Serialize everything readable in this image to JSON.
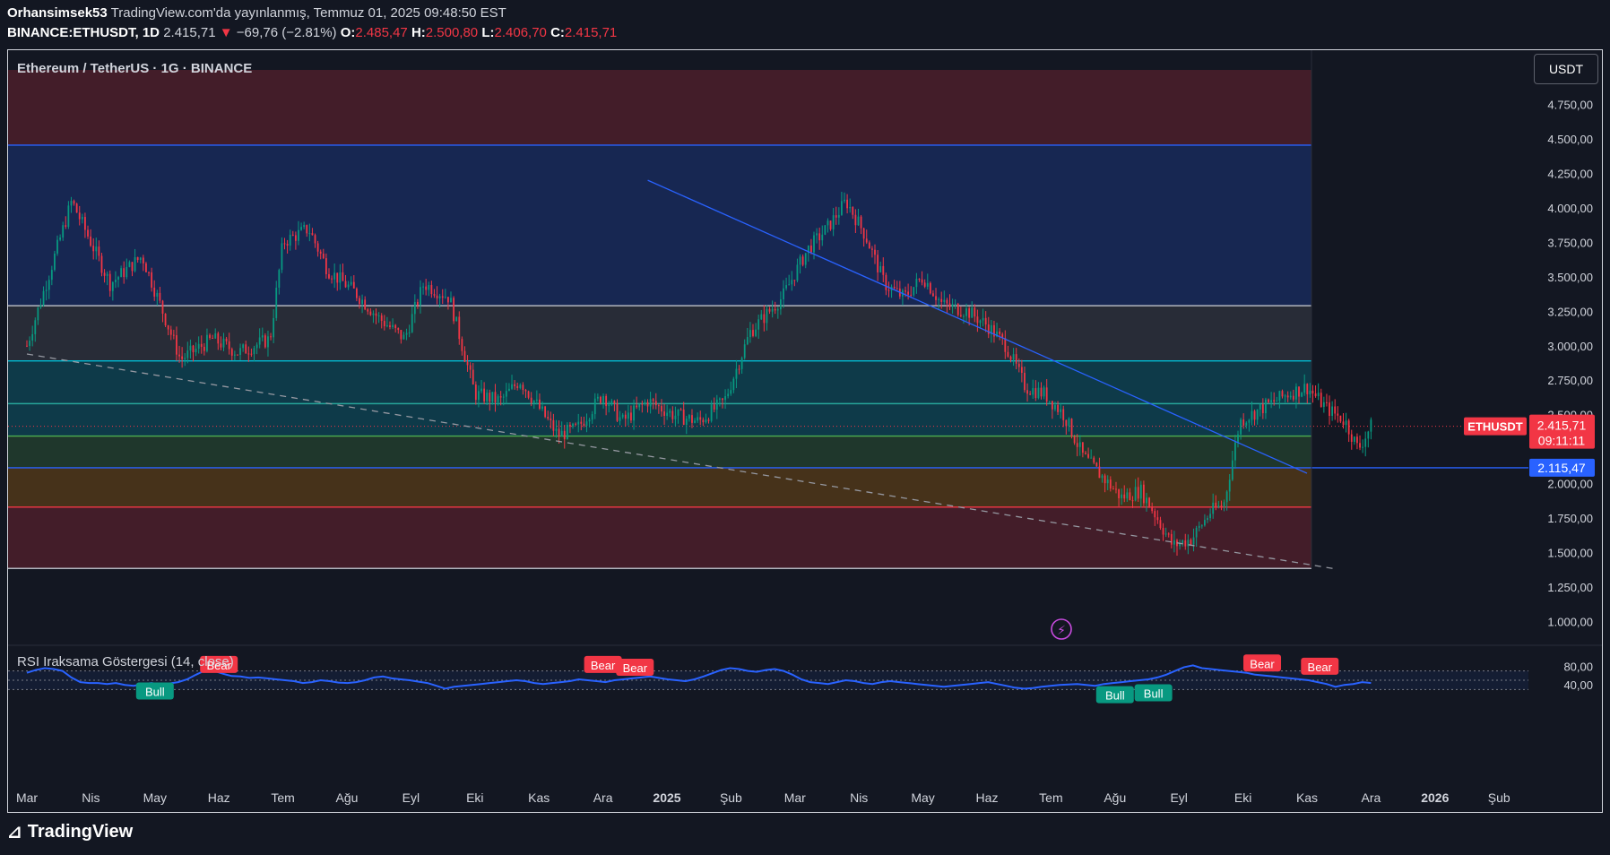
{
  "header": {
    "author": "Orhansimsek53",
    "published": "TradingView.com'da yayınlanmış, Temmuz 01, 2025 09:48:50 EST",
    "symbol_line": "BINANCE:ETHUSDT, 1D",
    "last": "2.415,71",
    "change": "−69,76 (−2.81%)",
    "o_label": "O:",
    "o": "2.485,47",
    "h_label": "H:",
    "h": "2.500,80",
    "l_label": "L:",
    "l": "2.406,70",
    "c_label": "C:",
    "c": "2.415,71"
  },
  "pane": {
    "title": "Ethereum / TetherUS · 1G · BINANCE",
    "currency": "USDT",
    "price_tag_symbol": "ETHUSDT",
    "price_tag_value": "2.415,71",
    "price_tag_timer": "09:11:11",
    "level_tag_value": "2.115,47",
    "rsi_title": "RSI Iraksama Göstergesi (14, close)"
  },
  "brand": {
    "name": "TradingView"
  },
  "colors": {
    "background": "#131722",
    "up": "#089981",
    "down": "#f23645",
    "rsi_line": "#2962ff",
    "trendline": "#2962ff",
    "zone_red": "#f23645",
    "zone_blue": "#2962ff",
    "zone_gray": "#787b86",
    "zone_teal": "#00bcd4",
    "zone_green": "#4caf50",
    "zone_orange": "#ff9800"
  },
  "chart_data": [
    {
      "type": "candlestick",
      "title": "Ethereum / TetherUS · 1G · BINANCE",
      "x_tick_labels": [
        "Mar",
        "Nis",
        "May",
        "Haz",
        "Tem",
        "Ağu",
        "Eyl",
        "Eki",
        "Kas",
        "Ara",
        "2025",
        "Şub",
        "Mar",
        "Nis",
        "May",
        "Haz",
        "Tem",
        "Ağu",
        "Eyl",
        "Eki",
        "Kas",
        "Ara",
        "2026",
        "Şub"
      ],
      "y_tick_labels": [
        "4.750,00",
        "4.500,00",
        "4.250,00",
        "4.000,00",
        "3.750,00",
        "3.500,00",
        "3.250,00",
        "3.000,00",
        "2.750,00",
        "2.500,00",
        "2.000,00",
        "1.750,00",
        "1.500,00",
        "1.250,00",
        "1.000,00"
      ],
      "y_ticks": [
        4750,
        4500,
        4250,
        4000,
        3750,
        3500,
        3250,
        3000,
        2750,
        2500,
        2000,
        1750,
        1500,
        1250,
        1000
      ],
      "ylim": [
        1000,
        4750
      ],
      "price_path": [
        {
          "month": 0.0,
          "price": 3000
        },
        {
          "month": 0.7,
          "price": 4050
        },
        {
          "month": 1.3,
          "price": 3450
        },
        {
          "month": 1.8,
          "price": 3650
        },
        {
          "month": 2.4,
          "price": 2900
        },
        {
          "month": 2.9,
          "price": 3050
        },
        {
          "month": 3.3,
          "price": 2950
        },
        {
          "month": 3.8,
          "price": 3050
        },
        {
          "month": 4.0,
          "price": 3750
        },
        {
          "month": 4.4,
          "price": 3850
        },
        {
          "month": 4.7,
          "price": 3550
        },
        {
          "month": 5.1,
          "price": 3400
        },
        {
          "month": 5.5,
          "price": 3200
        },
        {
          "month": 5.9,
          "price": 3050
        },
        {
          "month": 6.2,
          "price": 3450
        },
        {
          "month": 6.6,
          "price": 3350
        },
        {
          "month": 7.0,
          "price": 2650
        },
        {
          "month": 7.4,
          "price": 2600
        },
        {
          "month": 7.7,
          "price": 2750
        },
        {
          "month": 8.0,
          "price": 2550
        },
        {
          "month": 8.3,
          "price": 2350
        },
        {
          "month": 8.6,
          "price": 2400
        },
        {
          "month": 9.0,
          "price": 2650
        },
        {
          "month": 9.3,
          "price": 2450
        },
        {
          "month": 9.7,
          "price": 2600
        },
        {
          "month": 10.1,
          "price": 2500
        },
        {
          "month": 10.5,
          "price": 2450
        },
        {
          "month": 10.9,
          "price": 2600
        },
        {
          "month": 11.3,
          "price": 3100
        },
        {
          "month": 11.8,
          "price": 3350
        },
        {
          "month": 12.2,
          "price": 3700
        },
        {
          "month": 12.5,
          "price": 3850
        },
        {
          "month": 12.8,
          "price": 4050
        },
        {
          "month": 13.1,
          "price": 3800
        },
        {
          "month": 13.4,
          "price": 3450
        },
        {
          "month": 13.7,
          "price": 3350
        },
        {
          "month": 14.0,
          "price": 3500
        },
        {
          "month": 14.3,
          "price": 3300
        },
        {
          "month": 14.7,
          "price": 3250
        },
        {
          "month": 15.0,
          "price": 3150
        },
        {
          "month": 15.3,
          "price": 3000
        },
        {
          "month": 15.6,
          "price": 2700
        },
        {
          "month": 15.9,
          "price": 2650
        },
        {
          "month": 16.2,
          "price": 2500
        },
        {
          "month": 16.5,
          "price": 2200
        },
        {
          "month": 16.8,
          "price": 2050
        },
        {
          "month": 17.1,
          "price": 1900
        },
        {
          "month": 17.4,
          "price": 1950
        },
        {
          "month": 17.6,
          "price": 1800
        },
        {
          "month": 17.9,
          "price": 1550
        },
        {
          "month": 18.2,
          "price": 1600
        },
        {
          "month": 18.5,
          "price": 1800
        },
        {
          "month": 18.7,
          "price": 1850
        },
        {
          "month": 18.95,
          "price": 2450
        },
        {
          "month": 19.3,
          "price": 2550
        },
        {
          "month": 19.7,
          "price": 2650
        },
        {
          "month": 20.0,
          "price": 2700
        },
        {
          "month": 20.3,
          "price": 2550
        },
        {
          "month": 20.6,
          "price": 2450
        },
        {
          "month": 20.8,
          "price": 2250
        },
        {
          "month": 21.0,
          "price": 2415
        }
      ],
      "zones": [
        {
          "from": 4455,
          "to": 5000,
          "color": "red"
        },
        {
          "from": 3290,
          "to": 4455,
          "color": "blue"
        },
        {
          "from": 2890,
          "to": 3290,
          "color": "gray"
        },
        {
          "from": 2580,
          "to": 2890,
          "color": "teal"
        },
        {
          "from": 2345,
          "to": 2580,
          "color": "teal"
        },
        {
          "from": 2115,
          "to": 2345,
          "color": "green"
        },
        {
          "from": 1830,
          "to": 2115,
          "color": "orange"
        },
        {
          "from": 1385,
          "to": 1830,
          "color": "red"
        }
      ],
      "trendlines": [
        {
          "style": "solid",
          "color": "blue",
          "from": {
            "month": 9.7,
            "price": 4200
          },
          "to": {
            "month": 20.0,
            "price": 2075
          }
        },
        {
          "style": "dashed",
          "color": "gray",
          "from": {
            "month": 0.0,
            "price": 2940
          },
          "to": {
            "month": 20.4,
            "price": 1385
          }
        }
      ],
      "last_price": 2415.71,
      "marked_level": 2115.47
    },
    {
      "type": "line",
      "title": "RSI Iraksama Göstergesi (14, close)",
      "y_tick_labels": [
        "80,00",
        "40,00"
      ],
      "band": [
        30,
        70
      ],
      "midline": 50,
      "series": [
        {
          "values": [
            66,
            72,
            76,
            74,
            70,
            56,
            46,
            44,
            44,
            42,
            44,
            40,
            38,
            42,
            44,
            41,
            43,
            46,
            52,
            62,
            71,
            70,
            64,
            59,
            58,
            55,
            56,
            54,
            52,
            50,
            48,
            44,
            46,
            50,
            48,
            45,
            44,
            46,
            50,
            56,
            58,
            54,
            52,
            50,
            47,
            44,
            38,
            32,
            36,
            38,
            40,
            42,
            44,
            46,
            48,
            50,
            48,
            44,
            42,
            44,
            46,
            48,
            52,
            50,
            48,
            46,
            50,
            52,
            54,
            56,
            58,
            55,
            52,
            50,
            48,
            52,
            58,
            65,
            72,
            76,
            74,
            70,
            68,
            72,
            74,
            70,
            62,
            52,
            46,
            44,
            42,
            46,
            50,
            48,
            44,
            42,
            46,
            48,
            46,
            44,
            42,
            40,
            38,
            36,
            38,
            40,
            42,
            44,
            46,
            42,
            38,
            34,
            32,
            33,
            36,
            38,
            40,
            41,
            42,
            40,
            38,
            42,
            44,
            46,
            48,
            50,
            52,
            56,
            62,
            70,
            78,
            82,
            76,
            74,
            72,
            70,
            68,
            66,
            62,
            60,
            58,
            56,
            54,
            52,
            50,
            46,
            42,
            36,
            40,
            42,
            46,
            44
          ]
        }
      ],
      "labels": [
        {
          "text": "Bear",
          "kind": "bear",
          "month": 3.0,
          "value": 83
        },
        {
          "text": "Bull",
          "kind": "bull",
          "month": 2.0,
          "value": 26
        },
        {
          "text": "Bear",
          "kind": "bear",
          "month": 9.0,
          "value": 83
        },
        {
          "text": "Bear",
          "kind": "bear",
          "month": 9.5,
          "value": 77
        },
        {
          "text": "Bull",
          "kind": "bull",
          "month": 17.0,
          "value": 18
        },
        {
          "text": "Bull",
          "kind": "bull",
          "month": 17.6,
          "value": 22
        },
        {
          "text": "Bear",
          "kind": "bear",
          "month": 19.3,
          "value": 86
        },
        {
          "text": "Bear",
          "kind": "bear",
          "month": 20.2,
          "value": 79
        }
      ]
    }
  ]
}
